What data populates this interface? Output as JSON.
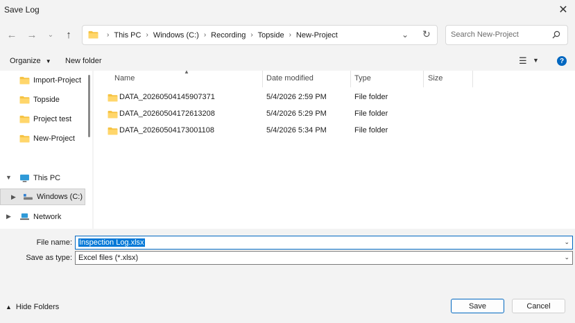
{
  "window": {
    "title": "Save Log"
  },
  "nav": {
    "breadcrumbs": [
      "This PC",
      "Windows (C:)",
      "Recording",
      "Topside",
      "New-Project"
    ],
    "search_placeholder": "Search New-Project"
  },
  "commands": {
    "organize": "Organize",
    "new_folder": "New folder"
  },
  "nav_pane": {
    "folders": [
      "Import-Project",
      "Topside",
      "Project test",
      "New-Project"
    ],
    "this_pc": "This PC",
    "drive": "Windows (C:)",
    "network": "Network"
  },
  "columns": [
    "Name",
    "Date modified",
    "Type",
    "Size"
  ],
  "files": [
    {
      "name": "DATA_20260504145907371",
      "date": "5/4/2026 2:59 PM",
      "type": "File folder",
      "size": ""
    },
    {
      "name": "DATA_20260504172613208",
      "date": "5/4/2026 5:29 PM",
      "type": "File folder",
      "size": ""
    },
    {
      "name": "DATA_20260504173001108",
      "date": "5/4/2026 5:34 PM",
      "type": "File folder",
      "size": ""
    }
  ],
  "form": {
    "file_name_label": "File name:",
    "file_name_value": "Inspection Log.xlsx",
    "save_type_label": "Save as type:",
    "save_type_value": "Excel files (*.xlsx)"
  },
  "footer": {
    "hide_folders": "Hide Folders",
    "save": "Save",
    "cancel": "Cancel"
  },
  "icons": {
    "back": "back-arrow-icon",
    "forward": "forward-arrow-icon",
    "recent": "chevron-down-icon",
    "up": "up-arrow-icon",
    "refresh": "refresh-icon",
    "search": "search-icon",
    "view": "view-list-icon",
    "help": "help-icon",
    "folder": "folder-icon",
    "pc": "monitor-icon",
    "drive": "drive-icon",
    "network": "network-icon",
    "close": "close-icon"
  },
  "colors": {
    "accent": "#0067c0",
    "selection": "#0078d7",
    "folder": "#f6c343"
  }
}
